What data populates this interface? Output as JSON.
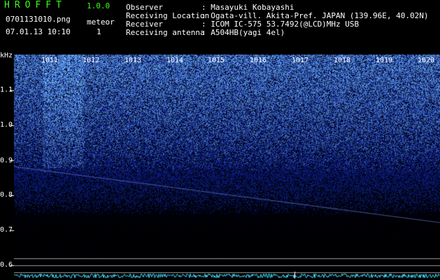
{
  "app": {
    "title": "HROFFT",
    "version": "1.0.0"
  },
  "file": {
    "name": "0701131010.png",
    "datetime": "07.01.13 10:10"
  },
  "meteor": {
    "label": "meteor",
    "count": "1"
  },
  "info": [
    {
      "label": "Observer",
      "value": ": Masayuki Kobayashi"
    },
    {
      "label": "Receiving Location",
      "value": ": Ogata-vill. Akita-Pref. JAPAN (139.96E, 40.02N)"
    },
    {
      "label": "Receiver",
      "value": ": ICOM IC-575 53.7492(@LCD)MHz USB"
    },
    {
      "label": "Receiving antenna",
      "value": ": A504HB(yagi 4el)"
    }
  ],
  "axis": {
    "unit": "kHz",
    "freq_labels": [
      "1.1",
      "1.0",
      "0.9",
      "0.8",
      "0.7",
      "0.6"
    ],
    "time_labels": [
      "1011",
      "1012",
      "1013",
      "1014",
      "1015",
      "1016",
      "1017",
      "1018",
      "1019",
      "1020"
    ]
  },
  "colors": {
    "title": "#39ff14",
    "noise": "#3050ff",
    "bottom_trace": "#40e0ff",
    "background": "#000000"
  }
}
